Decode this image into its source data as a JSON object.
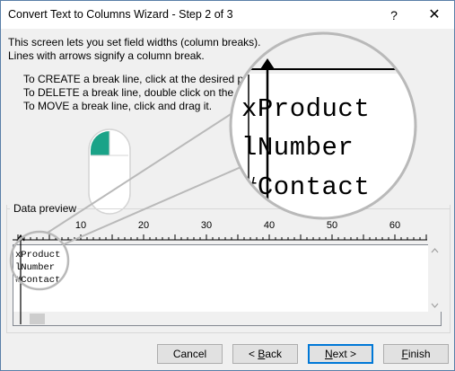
{
  "window": {
    "title": "Convert Text to Columns Wizard - Step 2 of 3",
    "help_label": "?",
    "close_label": "✕"
  },
  "intro": {
    "line1": "This screen lets you set field widths (column breaks).",
    "line2": "Lines with arrows signify a column break."
  },
  "instructions": {
    "create": "To CREATE a break line, click at the desired posi",
    "delete": "To DELETE a break line, double click on the lin",
    "move": "To MOVE a break line, click and drag it."
  },
  "preview": {
    "label": "Data preview",
    "ruler_ticks": [
      "10",
      "20",
      "30",
      "40",
      "50",
      "60"
    ],
    "rows": [
      "xProduct",
      "lNumber",
      "#Contact"
    ]
  },
  "magnified": {
    "rows": [
      "xProduct",
      "lNumber",
      "#Contact"
    ]
  },
  "buttons": {
    "cancel": "Cancel",
    "back_prefix": "< ",
    "back_key": "B",
    "back_rest": "ack",
    "next_key": "N",
    "next_rest": "ext >",
    "finish_key": "F",
    "finish_rest": "inish"
  },
  "colors": {
    "accent": "#0078d7",
    "mouse_button": "#1aa388"
  },
  "icons": {
    "mouse": "mouse-left-click-icon",
    "magnifier": "magnifier-callout"
  }
}
